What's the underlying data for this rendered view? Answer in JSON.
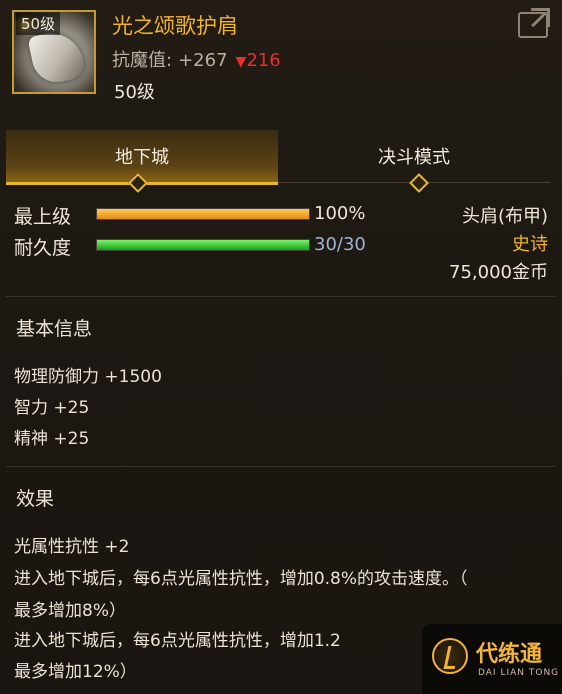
{
  "item": {
    "level_badge": "50级",
    "name": "光之颂歌护肩",
    "resist_label": "抗魔值:",
    "resist_value": "+267",
    "resist_diff_arrow": "▼",
    "resist_diff": "216",
    "level_text": "50级"
  },
  "tabs": [
    {
      "label": "地下城",
      "active": true
    },
    {
      "label": "决斗模式",
      "active": false
    }
  ],
  "stats": [
    {
      "label": "最上级",
      "value": "100%",
      "fill_fraction": 1.0,
      "color": "orange"
    },
    {
      "label": "耐久度",
      "value": "30/30",
      "fill_fraction": 1.0,
      "color": "green"
    }
  ],
  "right_info": {
    "slot": "头肩(布甲)",
    "rarity": "史诗",
    "price": "75,000金币"
  },
  "basic_info": {
    "title": "基本信息",
    "lines": [
      "物理防御力 +1500",
      "智力 +25",
      "精神 +25"
    ]
  },
  "effects": {
    "title": "效果",
    "lines": [
      "光属性抗性 +2",
      "进入地下城后，每6点光属性抗性，增加0.8%的攻击速度。（",
      "最多增加8%）",
      "进入地下城后，每6点光属性抗性，增加1.2",
      "最多增加12%）"
    ]
  },
  "watermark": {
    "title": "代练通",
    "subtitle": "DAI LIAN TONG"
  },
  "colors": {
    "gold": "#f3b32a",
    "rarity": "#f3b32a",
    "diff_red": "#e5302b",
    "durability_blue": "#9fb2d6"
  }
}
